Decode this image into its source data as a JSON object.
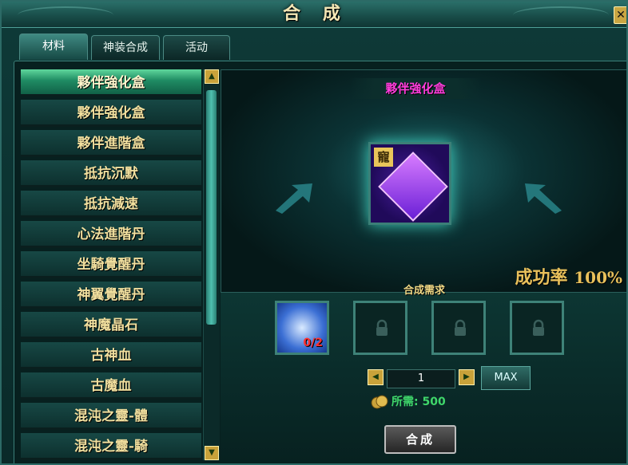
{
  "window": {
    "title": "合 成"
  },
  "tabs": [
    {
      "label": "材料",
      "active": true
    },
    {
      "label": "神装合成",
      "active": false
    },
    {
      "label": "活动",
      "active": false
    }
  ],
  "list": {
    "items": [
      {
        "label": "夥伴強化盒",
        "selected": true
      },
      {
        "label": "夥伴強化盒"
      },
      {
        "label": "夥伴進階盒"
      },
      {
        "label": "抵抗沉默"
      },
      {
        "label": "抵抗減速"
      },
      {
        "label": "心法進階丹"
      },
      {
        "label": "坐騎覺醒丹"
      },
      {
        "label": "神翼覺醒丹"
      },
      {
        "label": "神魔晶石"
      },
      {
        "label": "古神血"
      },
      {
        "label": "古魔血"
      },
      {
        "label": "混沌之靈-體"
      },
      {
        "label": "混沌之靈-騎"
      }
    ]
  },
  "preview": {
    "item_name": "夥伴強化盒",
    "item_tag": "寵",
    "success_label": "成功率",
    "success_value": "100%"
  },
  "requirements": {
    "label": "合成需求",
    "slots": [
      {
        "type": "material",
        "count": "0/2"
      },
      {
        "type": "locked"
      },
      {
        "type": "locked"
      },
      {
        "type": "locked"
      }
    ],
    "quantity": "1",
    "max_label": "MAX",
    "cost_label": "所需: 500",
    "craft_label": "合成"
  },
  "icons": [
    "close-icon",
    "scroll-up-icon",
    "scroll-down-icon",
    "arrow-left-icon",
    "arrow-right-icon",
    "lock-icon",
    "coin-icon"
  ],
  "colors": {
    "accent": "#3fd66a",
    "title": "#f3e6b4",
    "item_name": "#ff3ddc",
    "list_text": "#f1df9e"
  }
}
